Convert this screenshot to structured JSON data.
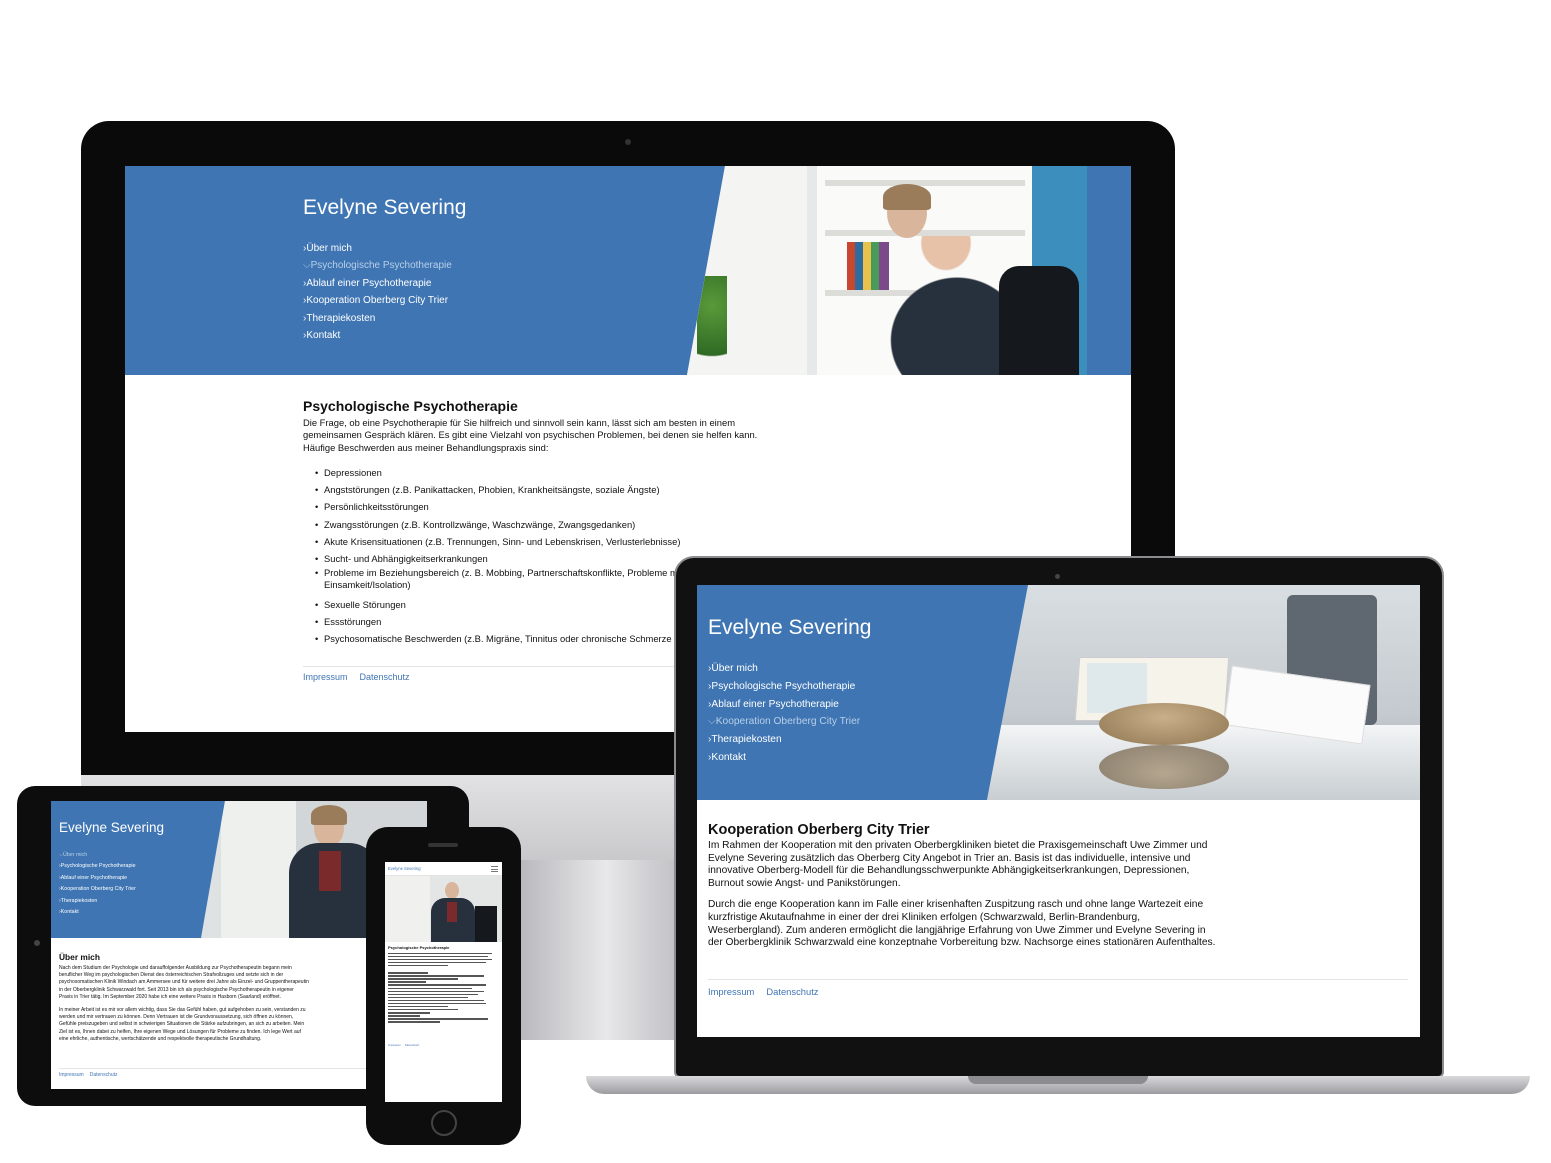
{
  "monitor": {
    "title": "Evelyne Severing",
    "nav": [
      {
        "label": "Über mich",
        "active": false
      },
      {
        "label": "Psychologische Psychotherapie",
        "active": true
      },
      {
        "label": "Ablauf einer Psychotherapie",
        "active": false
      },
      {
        "label": "Kooperation Oberberg City Trier",
        "active": false
      },
      {
        "label": "Therapiekosten",
        "active": false
      },
      {
        "label": "Kontakt",
        "active": false
      }
    ],
    "heading": "Psychologische Psychotherapie",
    "intro_1": "Die Frage, ob eine Psychotherapie für Sie hilfreich und sinnvoll sein kann, lässt sich am besten in einem",
    "intro_2": "gemeinsamen Gespräch klären. Es gibt eine Vielzahl von psychischen Problemen, bei denen sie helfen kann.",
    "intro_3": "Häufige Beschwerden aus meiner Behandlungspraxis sind:",
    "list": [
      "Depressionen",
      "Angststörungen (z.B. Panikattacken, Phobien, Krankheitsängste, soziale Ängste)",
      "Persönlichkeitsstörungen",
      "Zwangsstörungen (z.B. Kontrollzwänge, Waschzwänge, Zwangsgedanken)",
      "Akute Krisensituationen (z.B. Trennungen, Sinn- und Lebenskrisen, Verlusterlebnisse)",
      "Sucht- und Abhängigkeitserkrankungen",
      "Probleme im Beziehungsbereich (z. B. Mobbing, Partnerschaftskonflikte, Probleme m",
      "Sexuelle Störungen",
      "Essstörungen",
      "Psychosomatische Beschwerden (z.B. Migräne, Tinnitus oder chronische Schmerze"
    ],
    "list_item_7_line2": "Einsamkeit/Isolation)",
    "footer": {
      "impressum": "Impressum",
      "datenschutz": "Datenschutz"
    }
  },
  "laptop": {
    "title": "Evelyne Severing",
    "nav": [
      {
        "label": "Über mich",
        "active": false
      },
      {
        "label": "Psychologische Psychotherapie",
        "active": false
      },
      {
        "label": "Ablauf einer Psychotherapie",
        "active": false
      },
      {
        "label": "Kooperation Oberberg City Trier",
        "active": true
      },
      {
        "label": "Therapiekosten",
        "active": false
      },
      {
        "label": "Kontakt",
        "active": false
      }
    ],
    "heading": "Kooperation Oberberg City Trier",
    "p1": [
      "Im Rahmen der Kooperation mit den privaten Oberbergkliniken bietet die Praxisgemeinschaft Uwe Zimmer und",
      "Evelyne Severing zusätzlich das Oberberg City Angebot in Trier an. Basis ist das individuelle, intensive und",
      "innovative Oberberg-Modell für die Behandlungsschwerpunkte Abhängigkeitserkrankungen, Depressionen,",
      "Burnout sowie Angst- und Panikstörungen."
    ],
    "p2": [
      "Durch die enge Kooperation kann im Falle einer krisenhaften Zuspitzung rasch und ohne lange Wartezeit eine",
      "kurzfristige Akutaufnahme in einer der drei Kliniken erfolgen (Schwarzwald, Berlin-Brandenburg,",
      "Weserbergland). Zum anderen ermöglicht die langjährige Erfahrung von Uwe Zimmer und Evelyne Severing in",
      "der Oberbergklinik Schwarzwald eine konzeptnahe Vorbereitung bzw. Nachsorge eines stationären Aufenthaltes."
    ],
    "footer": {
      "impressum": "Impressum",
      "datenschutz": "Datenschutz"
    }
  },
  "tablet": {
    "title": "Evelyne Severing",
    "nav": [
      {
        "label": "Über mich",
        "active": true
      },
      {
        "label": "Psychologische Psychotherapie",
        "active": false
      },
      {
        "label": "Ablauf einer Psychotherapie",
        "active": false
      },
      {
        "label": "Kooperation Oberberg City Trier",
        "active": false
      },
      {
        "label": "Therapiekosten",
        "active": false
      },
      {
        "label": "Kontakt",
        "active": false
      }
    ],
    "heading": "Über mich",
    "p1": [
      "Nach dem Studium der Psychologie und darauffolgender Ausbildung zur Psychotherapeutin begann mein",
      "beruflicher Weg im psychologischen Dienst des österreichischen Strafvollzuges und setzte sich in der",
      "psychosomatischen Klinik Windach am Ammersee und für weitere drei Jahre als Einzel- und Gruppentherapeutin",
      "in der Oberbergklinik Schwarzwald fort. Seit 2013 bin ich als psychologische Psychotherapeutin in eigener",
      "Praxis in Trier tätig. Im September 2020 habe ich eine weitere Praxis in Hasborn (Saarland) eröffnet."
    ],
    "p2": [
      "In meiner Arbeit ist es mir vor allem wichtig, dass Sie das Gefühl haben, gut aufgehoben zu sein, verstanden zu",
      "werden und mir vertrauen zu können. Denn Vertrauen ist die Grundvoraussetzung, sich öffnen zu können,",
      "Gefühle preiszugeben und selbst in schwierigen Situationen die Stärke aufzubringen, an sich zu arbeiten. Mein",
      "Ziel ist es, Ihnen dabei zu helfen, Ihre eigenen Wege und Lösungen für Probleme zu finden. Ich lege Wert auf",
      "eine ehrliche, authentische, wertschätzende und respektvolle therapeutische Grundhaltung."
    ],
    "footer": {
      "impressum": "Impressum",
      "datenschutz": "Datenschutz"
    }
  },
  "phone": {
    "title": "Evelyne Severing",
    "heading": "Psychologische Psychotherapie",
    "footer": {
      "impressum": "Impressum",
      "datenschutz": "Datenschutz"
    }
  },
  "colors": {
    "brand_blue": "#3f75b3",
    "active_nav": "#b8cfe9",
    "link": "#3f75b3"
  }
}
